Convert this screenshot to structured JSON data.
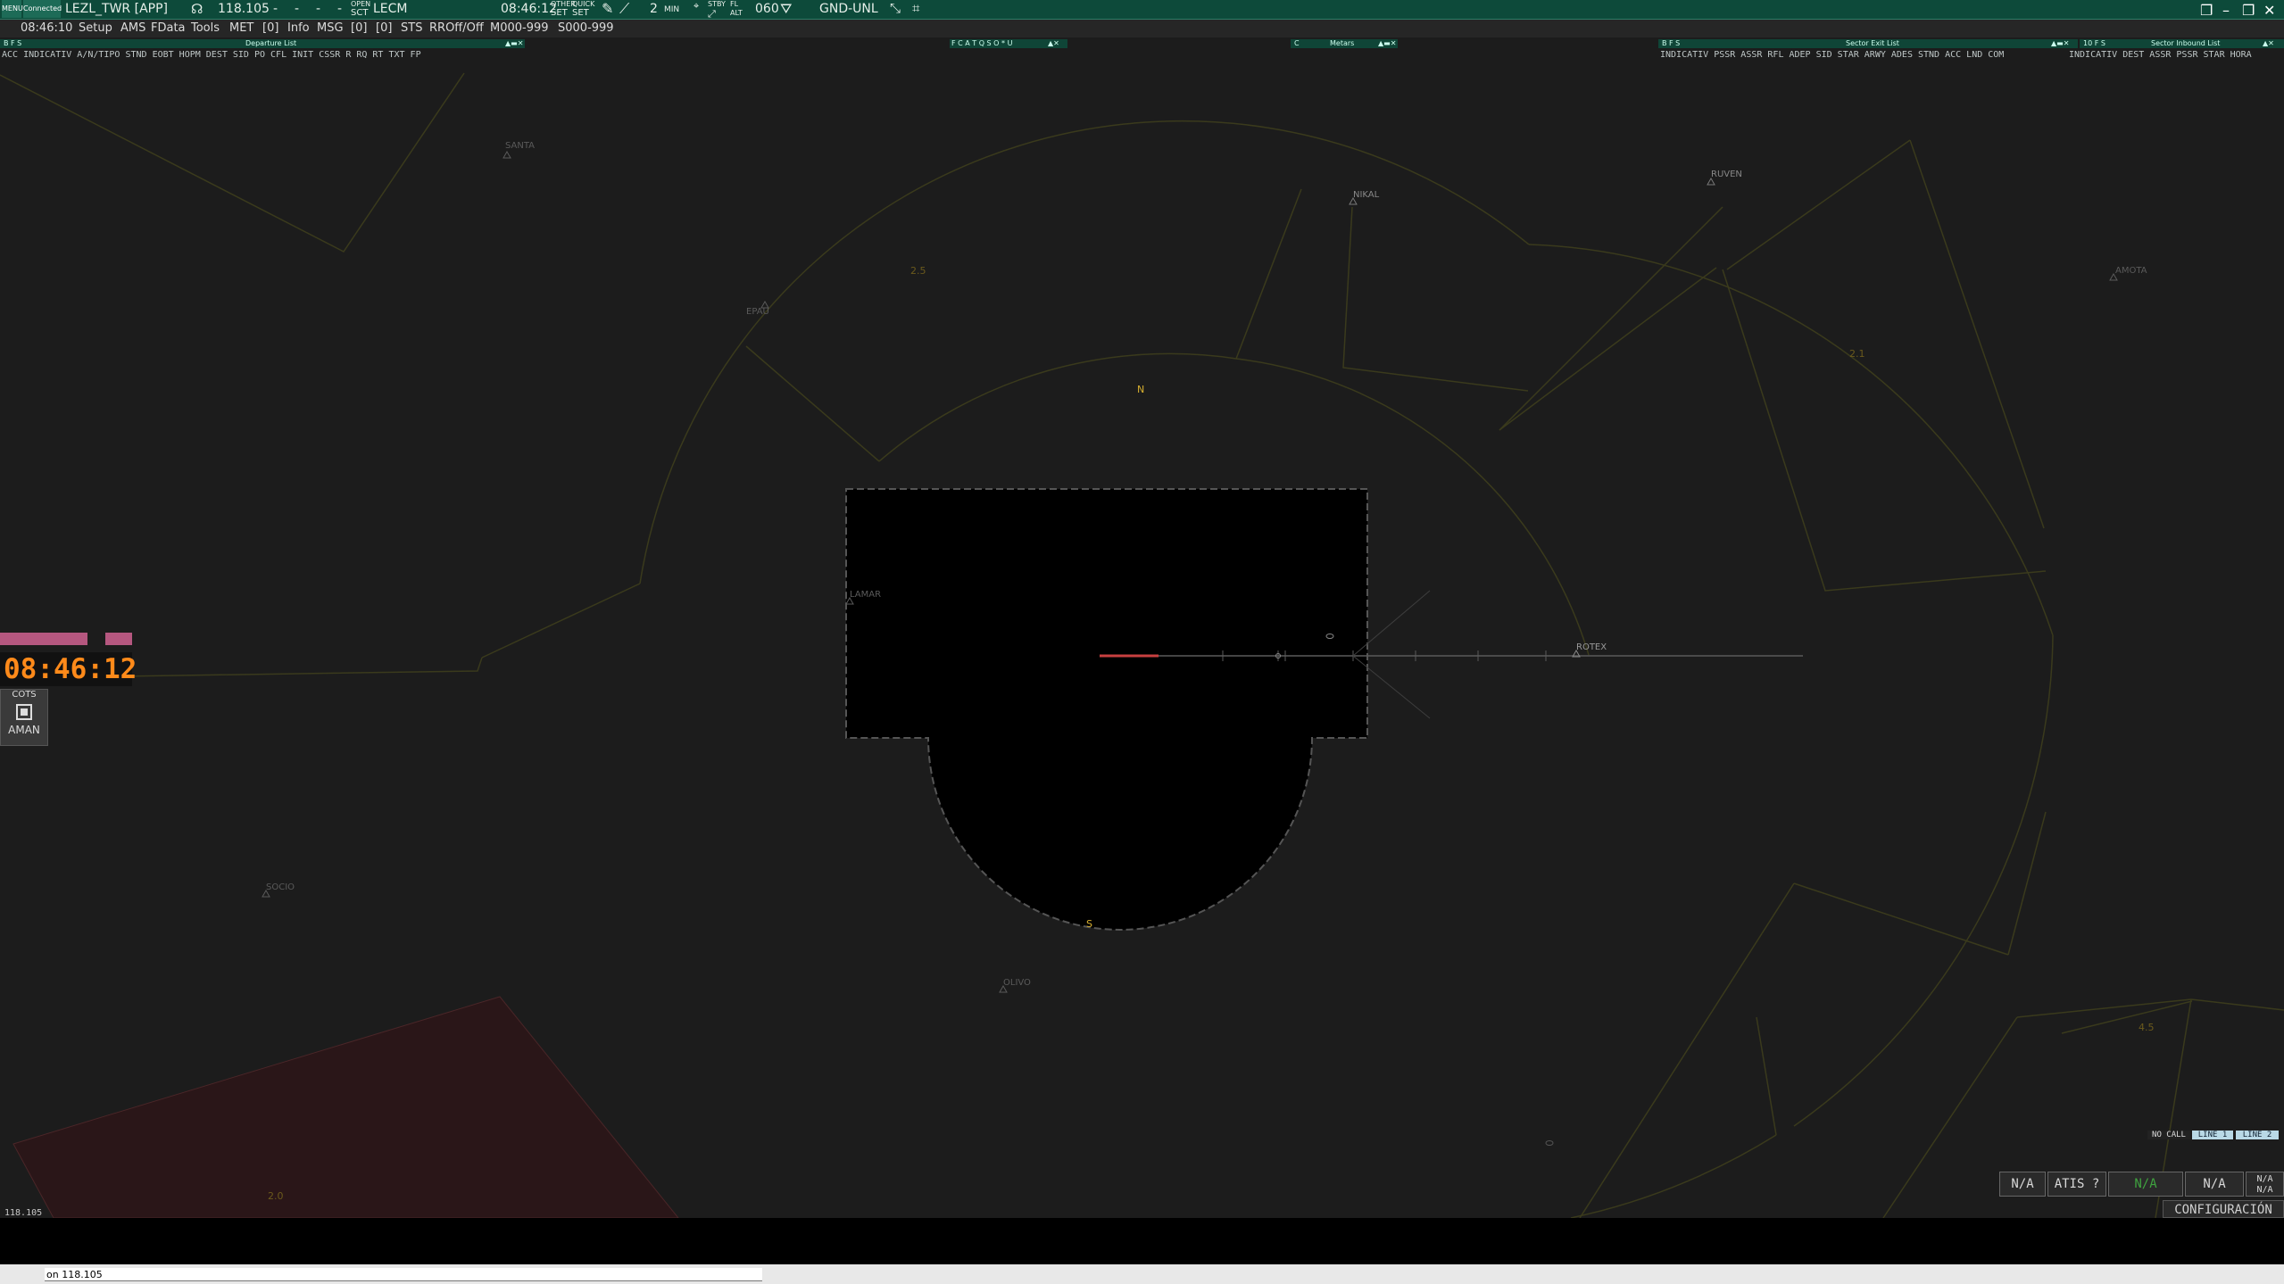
{
  "topbar": {
    "menu_label": "MENU",
    "connected_label": "Connected",
    "station": "LEZL_TWR [APP]",
    "frequency": "118.105",
    "dash1": "-",
    "dash2": "-",
    "dash3": "-",
    "dash4": "-",
    "open_label": "OPEN",
    "sct_label": "SCT",
    "sector": "LECM",
    "time": "08:46:12",
    "other_label": "OTHER",
    "other_set": "SET",
    "quick_label": "QUICK",
    "quick_set": "SET",
    "min_value": "2",
    "min_label": "MIN",
    "stby_label": "STBY",
    "fl_label": "FL",
    "alt_label": "ALT",
    "fl_value": "060",
    "gnd_label": "GND-UNL"
  },
  "menubar": {
    "time": "08:46:10",
    "items": [
      "Setup",
      "AMS",
      "FData",
      "Tools",
      "MET",
      "[0]",
      "Info",
      "MSG",
      "[0]",
      "[0]",
      "STS",
      "RROff/Off",
      "M000-999",
      "S000-999"
    ]
  },
  "lists": {
    "departure": {
      "title": "Departure List",
      "flags": "B F S",
      "header": "ACC INDICATIV A/N/TIPO STND  EOBT  HOPM  DEST    SID      PO    CFL    INIT  CSSR  R  RQ  RT       TXT       FP"
    },
    "fcat": {
      "title": "F C A T Q S O * U"
    },
    "metars": {
      "title": "Metars",
      "flag": "C"
    },
    "sector_exit": {
      "title": "Sector Exit List",
      "flags": "B F S",
      "header": "INDICATIV PSSR  ASSR  RFL  ADEP    SID      STAR   ARWY ADES  STND   ACC  LND COM"
    },
    "sector_inbound": {
      "title": "Sector Inbound List",
      "flags": "10 F S",
      "header": "INDICATIV  DEST   ASSR  PSSR   STAR   HORA"
    }
  },
  "radar": {
    "fixes": [
      {
        "name": "SANTA"
      },
      {
        "name": "NIKAL"
      },
      {
        "name": "RUVEN"
      },
      {
        "name": "AMOTA"
      },
      {
        "name": "EPAU"
      },
      {
        "name": "LAMAR"
      },
      {
        "name": "ROTEX"
      },
      {
        "name": "SOCIO"
      },
      {
        "name": "OLIVO"
      }
    ],
    "compass_n": "N",
    "compass_s": "S",
    "sector_numbers": [
      "2.5",
      "2.1",
      "4.5",
      "2.0"
    ]
  },
  "clock": {
    "time": "08:46:12"
  },
  "cots": {
    "label": "COTS",
    "aman_label": "AMAN"
  },
  "status": {
    "freq_small": "118.105",
    "no_call": "NO CALL",
    "line1": "LINE 1",
    "line2": "LINE 2",
    "na1": "N/A",
    "atis": "ATIS ?",
    "na_green": "N/A",
    "na2": "N/A",
    "na3": "N/A",
    "na4": "N/A",
    "config": "CONFIGURACIÓN"
  },
  "command": {
    "value": "on 118.105"
  },
  "colors": {
    "topbar": "#0d4a3a",
    "clock": "#ff8a1a",
    "pink": "#b5577f",
    "sector_line": "#3a3a1c",
    "restricted": "#2a1618"
  }
}
